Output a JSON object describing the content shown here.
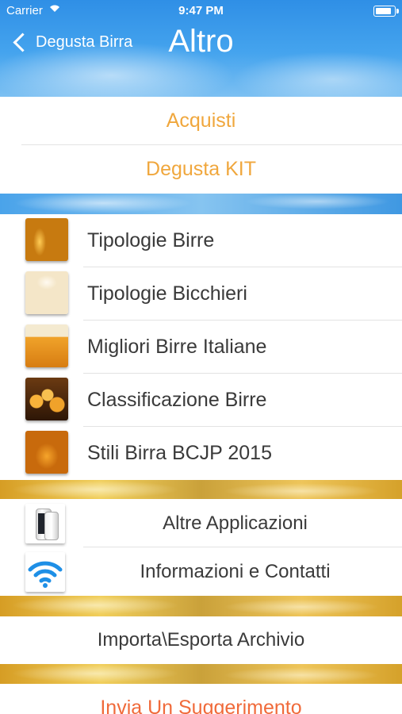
{
  "status_bar": {
    "carrier": "Carrier",
    "time": "9:47 PM"
  },
  "nav": {
    "back_label": "Degusta Birra",
    "title": "Altro"
  },
  "section1": {
    "items": [
      {
        "label": "Acquisti"
      },
      {
        "label": "Degusta KIT"
      }
    ]
  },
  "section2": {
    "items": [
      {
        "label": "Tipologie Birre",
        "icon": "beer-glasses-thumbnail"
      },
      {
        "label": "Tipologie Bicchieri",
        "icon": "beer-glass-foam-thumbnail"
      },
      {
        "label": "Migliori Birre Italiane",
        "icon": "beer-pint-thumbnail"
      },
      {
        "label": "Classificazione Birre",
        "icon": "beer-mugs-thumbnail"
      },
      {
        "label": "Stili Birra BCJP 2015",
        "icon": "beer-mug-thumbnail"
      }
    ]
  },
  "section3": {
    "items": [
      {
        "label": "Altre Applicazioni",
        "icon": "iphone-icon"
      },
      {
        "label": "Informazioni e Contatti",
        "icon": "wifi-icon"
      }
    ]
  },
  "section4": {
    "items": [
      {
        "label": "Importa\\Esporta Archivio"
      }
    ]
  },
  "section5": {
    "items": [
      {
        "label": "Invia Un Suggerimento"
      }
    ]
  },
  "colors": {
    "accent_orange": "#f0a73d",
    "suggest_red": "#f06a3a",
    "header_blue": "#3f98e2",
    "band_gold": "#e0b040"
  }
}
